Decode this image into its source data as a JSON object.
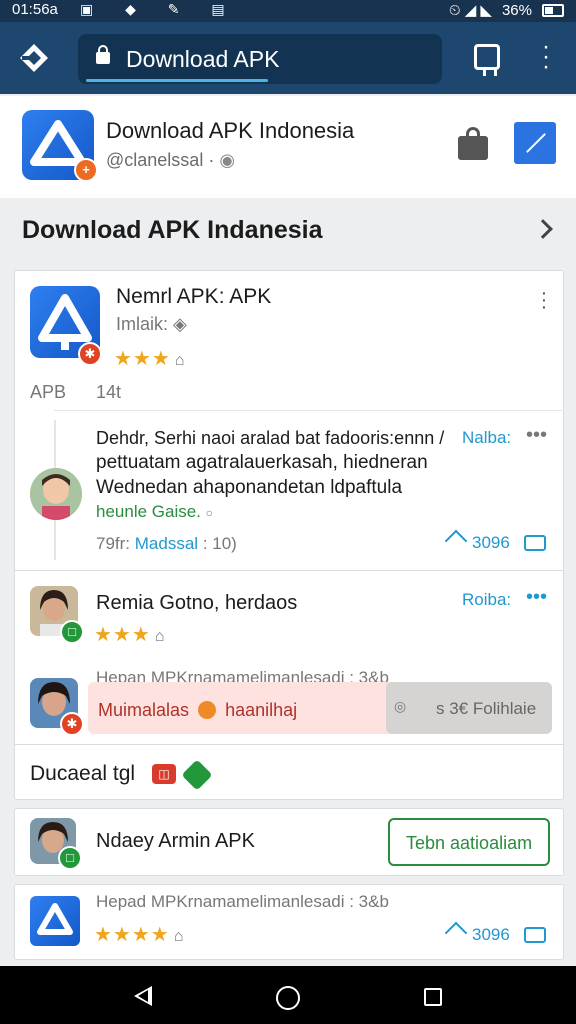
{
  "status_bar": {
    "time": "01:56a",
    "icons": "▣ ◆ ✎ ▤",
    "right": "⏲ ◢ ◣",
    "battery_percent": "36%"
  },
  "toolbar": {
    "url": "Download APK"
  },
  "header": {
    "title": "Download APK Indonesia",
    "subtitle": "@clanelssal ·"
  },
  "section": {
    "title": "Download APK Indanesia"
  },
  "featured": {
    "name": "Nemrl APK: APK",
    "developer": "Imlaik:",
    "rating_stars": 3,
    "row_label": "APB",
    "row_value": "14t"
  },
  "comments": [
    {
      "line1": "Dehdr, Serhi naoi aralad bat fadooris:ennn /",
      "tag": "Nalba:",
      "line2": "pettuatam agatralauerkasah, hiedneran",
      "line3": "Wednedan ahaponandetan ldpaftula",
      "line4": "heunle Gaise.",
      "meta_left": "79fr:",
      "meta_link": "Madssal",
      "meta_tail": ": 10)",
      "stat": "3096"
    },
    {
      "name": "Remia Gotno, herdaos",
      "tag": "Roiba:",
      "rating_stars": 3,
      "reply_head": "Hepan MPKrnamamelimanlesadi : 3&b",
      "reply_text": "Muimalalas",
      "reply_link": "haanilhaj",
      "reply_action": "s 3€ Folihlaie"
    }
  ],
  "footer_row": {
    "text": "Ducaeal tgl"
  },
  "promo": {
    "name": "Ndaey Armin APK",
    "button": "Tebn aatioaliam"
  },
  "last_item": {
    "head": "Hepad MPKrnamamelimanlesadi : 3&b",
    "rating_stars": 4,
    "stat": "3096"
  }
}
